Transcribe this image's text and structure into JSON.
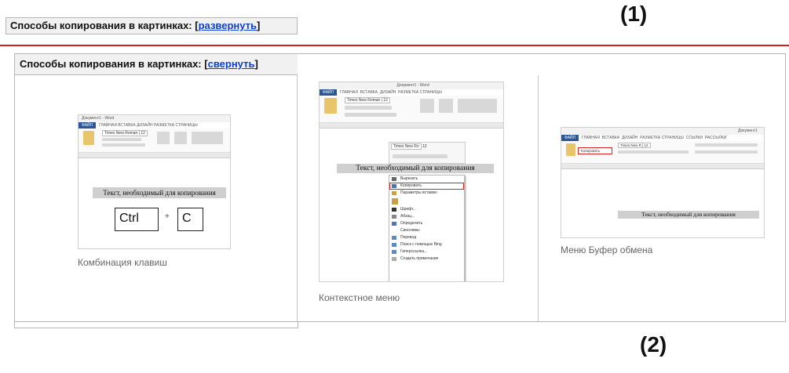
{
  "collapsed": {
    "title": "Способы копирования в картинках:",
    "link": "развернуть",
    "label": "(1)"
  },
  "expanded": {
    "title": "Способы копирования в картинках:",
    "link": "свернуть",
    "items": [
      {
        "caption": "Комбинация клавиш",
        "shot": {
          "titlebar": "Документ1 - Word",
          "tabs": [
            "ФАЙЛ",
            "ГЛАВНАЯ",
            "ВСТАВКА",
            "ДИЗАЙН",
            "РАЗМЕТКА СТРАНИЦЫ"
          ],
          "font": "Times New Roman",
          "size": "12",
          "text": "Текст, необходимый для копирования",
          "key1": "Ctrl",
          "plus": "+",
          "key2": "C"
        }
      },
      {
        "caption": "Контекстное меню",
        "shot": {
          "titlebar": "Документ1 - Word",
          "tabs": [
            "ФАЙЛ",
            "ГЛАВНАЯ",
            "ВСТАВКА",
            "ДИЗАЙН",
            "РАЗМЕТКА СТРАНИЦЫ"
          ],
          "font": "Times New Roman",
          "mini_font": "Times New Ro",
          "size": "12",
          "text": "Текст, необходимый для копирования",
          "menu": [
            "Вырезать",
            "Копировать",
            "Параметры вставки:",
            "",
            "Шрифт...",
            "Абзац...",
            "Определить",
            "Синонимы",
            "Перевод",
            "Поиск с помощью Bing",
            "Гиперссылка...",
            "Создать примечание"
          ]
        }
      },
      {
        "caption": "Меню Буфер обмена",
        "shot": {
          "titlebar": "Документ1",
          "tabs": [
            "ФАЙЛ",
            "ГЛАВНАЯ",
            "ВСТАВКА",
            "ДИЗАЙН",
            "РАЗМЕТКА СТРАНИЦЫ",
            "ССЫЛКИ",
            "РАССЫЛКИ"
          ],
          "font": "Times New R",
          "size": "12",
          "copy_item": "Копировать",
          "text": "Текст, необходимый для копирования"
        }
      }
    ],
    "label": "(2)"
  }
}
